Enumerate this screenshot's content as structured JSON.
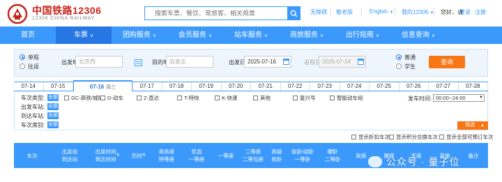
{
  "header": {
    "brand_cn": "中国铁路12306",
    "brand_en": "12306 CHINA RAILWAY",
    "search_placeholder": "搜索车票、餐饮、常旅客、相关规章",
    "links": {
      "barrier_free": "无障碍",
      "senior": "敬老版",
      "language": "English",
      "my12306": "我的12306",
      "greeting": "您好，请",
      "login": "登录",
      "register": "注册"
    }
  },
  "nav": {
    "items": [
      "首页",
      "车票",
      "团购服务",
      "会员服务",
      "站车服务",
      "商旅服务",
      "出行指南",
      "信息查询"
    ],
    "active_index": 1
  },
  "query": {
    "trip_type": [
      "单程",
      "往返"
    ],
    "from_label": "出发地",
    "from_value": "北京西",
    "to_label": "目的地",
    "to_value": "石家庄",
    "depart_label": "出发日",
    "depart_value": "2025-07-16",
    "return_label": "返程日",
    "return_value": "2025-07-14",
    "ticket_type": [
      "普通",
      "学生"
    ],
    "search_button": "查询"
  },
  "dates": {
    "items": [
      "07-14",
      "07-15",
      "07-16",
      "07-17",
      "07-18",
      "07-19",
      "07-20",
      "07-21",
      "07-22",
      "07-23",
      "07-24",
      "07-25",
      "07-26",
      "07-27",
      "07-28"
    ],
    "active": "07-16",
    "active_weekday": "周三"
  },
  "filters": {
    "train_type_label": "车次类型:",
    "depart_station_label": "出发车站:",
    "arrive_station_label": "到达车站:",
    "seat_label": "车次席别:",
    "all_label": "全部",
    "train_types": [
      "GC-高铁/城际",
      "D-动车",
      "Z-直达",
      "T-特快",
      "K-快速",
      "其他",
      "复兴号",
      "智能动车组"
    ],
    "time_label": "发车时间:",
    "time_value": "00:00--24:00",
    "collapse_label": "筛选"
  },
  "options": [
    "显示折扣车次",
    "显示积分兑换车次",
    "显示全部可预订车次"
  ],
  "results_header": {
    "columns": [
      {
        "l1": "车次",
        "l2": ""
      },
      {
        "l1": "出发站",
        "l2": "到达站"
      },
      {
        "l1": "出发时间",
        "l2": "到达时间"
      },
      {
        "l1": "历时",
        "l2": ""
      },
      {
        "l1": "商务座",
        "l2": "特等座"
      },
      {
        "l1": "优选",
        "l2": "一等座"
      },
      {
        "l1": "一等座",
        "l2": ""
      },
      {
        "l1": "二等座",
        "l2": "二等包座"
      },
      {
        "l1": "高级",
        "l2": "软卧"
      },
      {
        "l1": "软卧/动卧",
        "l2": "一等卧"
      },
      {
        "l1": "硬卧",
        "l2": "二等卧"
      },
      {
        "l1": "软座",
        "l2": ""
      },
      {
        "l1": "硬座",
        "l2": ""
      },
      {
        "l1": "无座",
        "l2": ""
      },
      {
        "l1": "其他",
        "l2": ""
      },
      {
        "l1": "备注",
        "l2": ""
      }
    ]
  },
  "watermark": "公众号 · 量子位",
  "colors": {
    "primary_blue": "#3b99fc",
    "active_blue": "#2676e3",
    "orange": "#f87613",
    "brand_red": "#c8251d"
  }
}
